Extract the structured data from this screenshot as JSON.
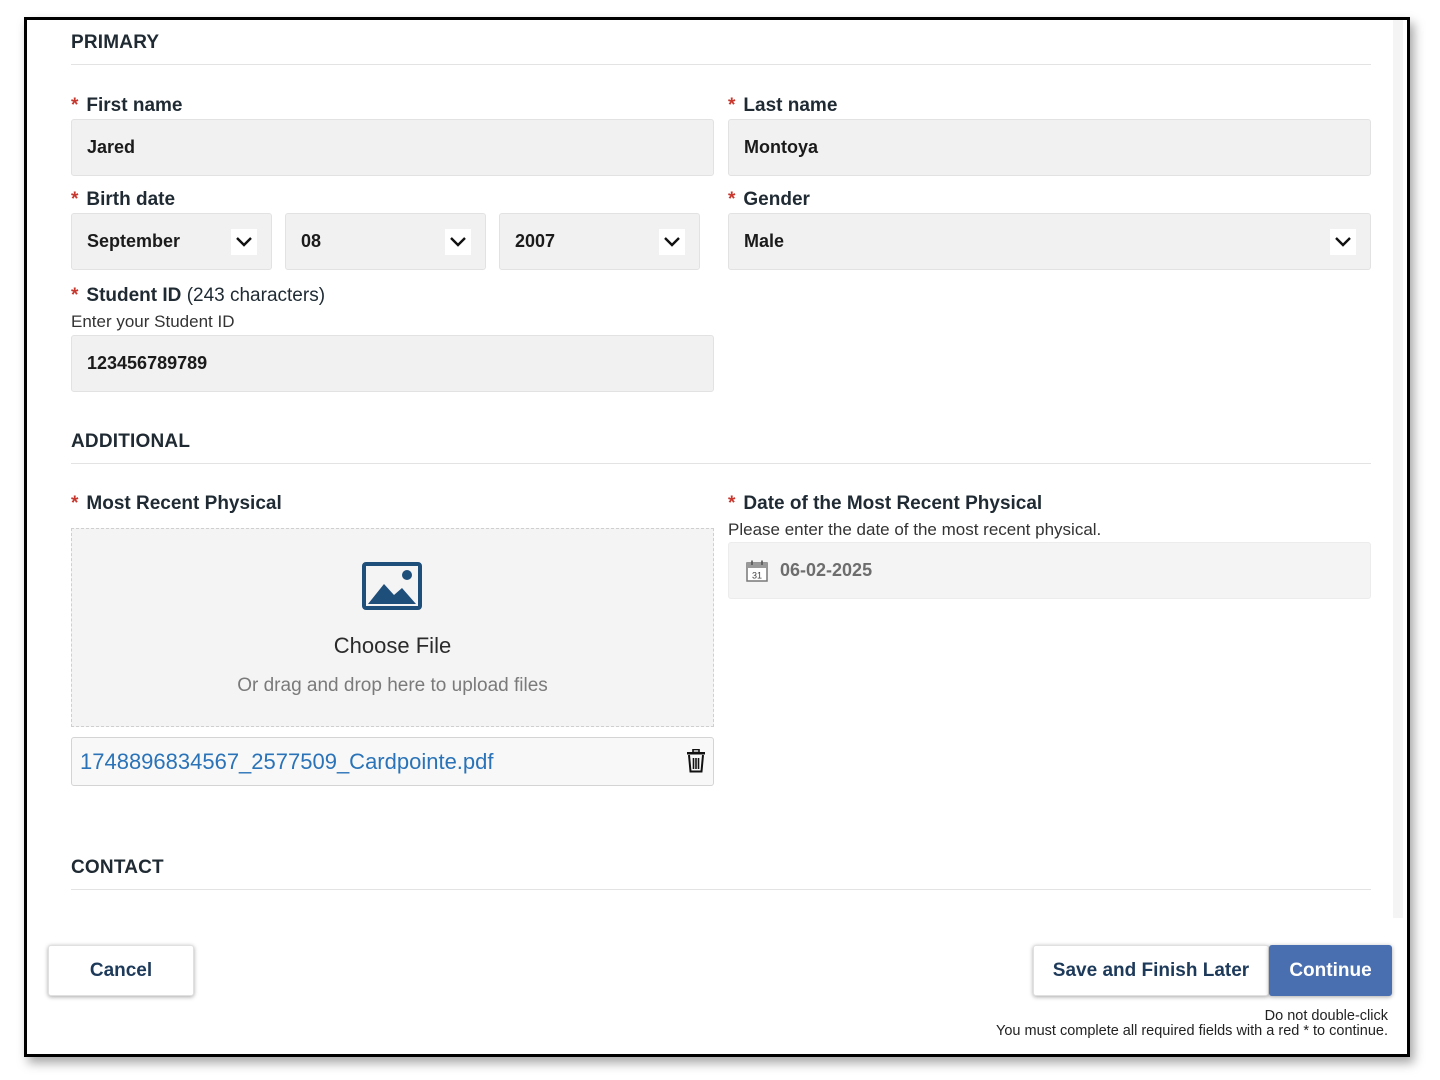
{
  "sections": {
    "primary": "PRIMARY",
    "additional": "ADDITIONAL",
    "contact": "CONTACT"
  },
  "required_marker": "*",
  "first_name": {
    "label": "First name",
    "value": "Jared"
  },
  "last_name": {
    "label": "Last name",
    "value": "Montoya"
  },
  "birth_date": {
    "label": "Birth date",
    "month": "September",
    "day": "08",
    "year": "2007"
  },
  "gender": {
    "label": "Gender",
    "value": "Male"
  },
  "student_id": {
    "label": "Student ID",
    "counter": "(243 characters)",
    "help": "Enter your Student ID",
    "value": "123456789789"
  },
  "physical": {
    "label": "Most Recent Physical",
    "choose_file": "Choose File",
    "drag_drop": "Or drag and drop here to upload files",
    "file_name": "1748896834567_2577509_Cardpointe.pdf",
    "upload_icon": "image-icon",
    "delete_icon": "trash-icon"
  },
  "physical_date": {
    "label": "Date of the Most Recent Physical",
    "help": "Please enter the date of the most recent physical.",
    "value": "06-02-2025",
    "calendar_day": "31",
    "icon": "calendar-icon"
  },
  "footer": {
    "cancel": "Cancel",
    "save_later": "Save and Finish Later",
    "continue": "Continue",
    "note_double_click": "Do not double-click",
    "note_required": "You must complete all required fields with a red * to continue."
  },
  "colors": {
    "required": "#c8372d",
    "link": "#2a73b8",
    "primary_button": "#4a6fb0",
    "icon": "#1e4e7a"
  }
}
